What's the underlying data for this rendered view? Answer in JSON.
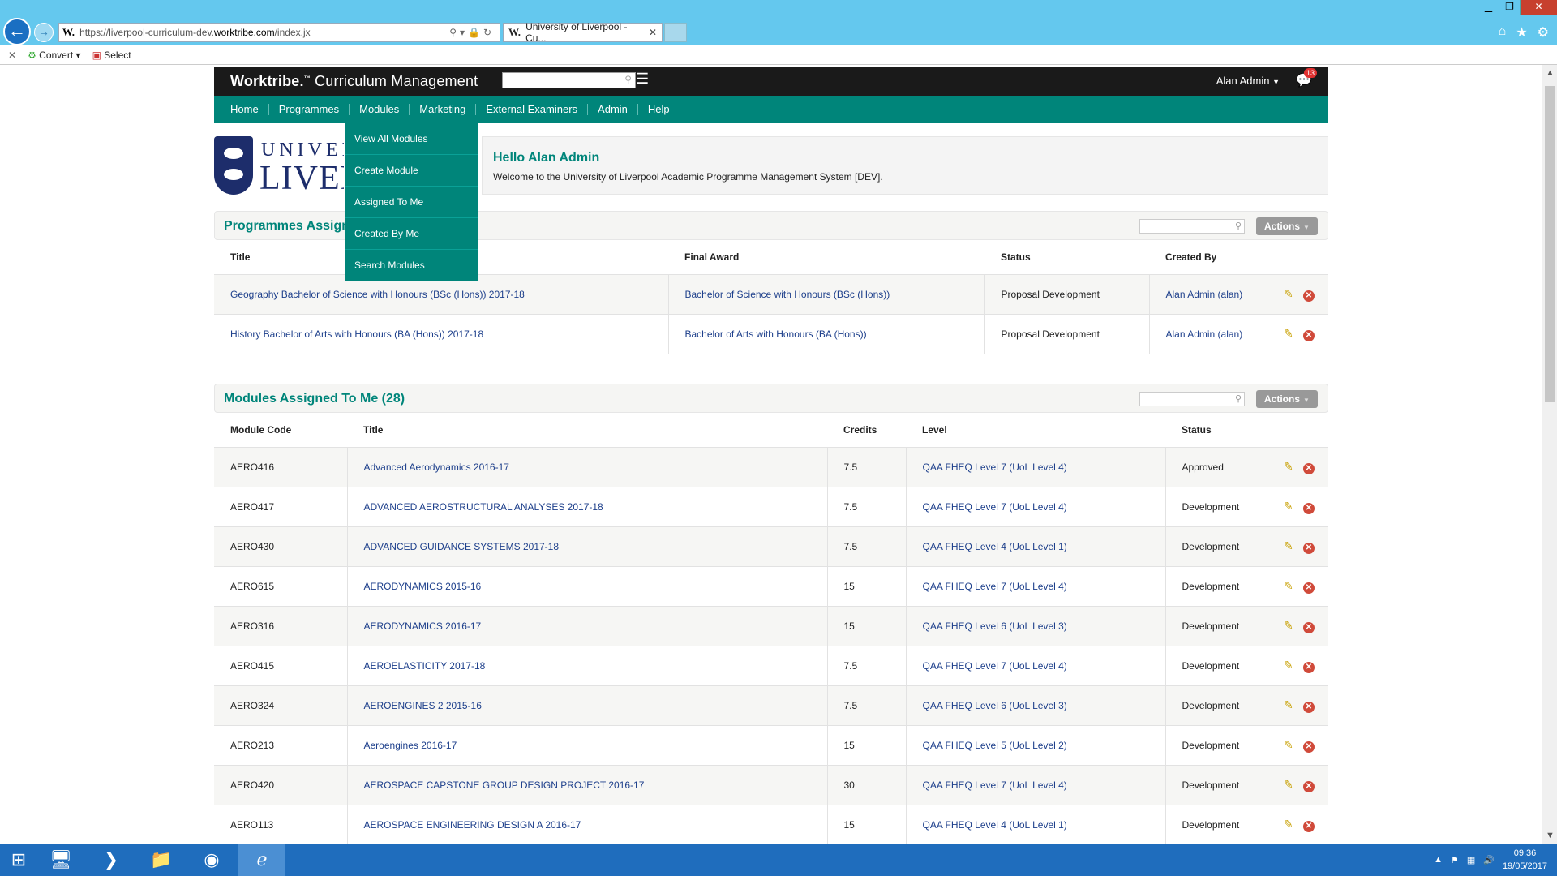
{
  "browser": {
    "url_prefix": "https://liverpool-curriculum-dev.",
    "url_domain": "worktribe.com",
    "url_path": "/index.jx",
    "tab_title": "University of Liverpool - Cu...",
    "favicon": "W.",
    "cmd_convert": "Convert",
    "cmd_select": "Select"
  },
  "app": {
    "brand": "Worktribe.",
    "brand_tm": "™",
    "brand_sub": "Curriculum Management",
    "user": "Alan Admin",
    "notifications": "13"
  },
  "nav": [
    "Home",
    "Programmes",
    "Modules",
    "Marketing",
    "External Examiners",
    "Admin",
    "Help"
  ],
  "modules_menu": [
    "View All Modules",
    "Create Module",
    "Assigned To Me",
    "Created By Me",
    "Search Modules"
  ],
  "logo": {
    "line1": "UNIVER",
    "line2": "LIVER"
  },
  "welcome": {
    "heading": "Hello Alan Admin",
    "text": "Welcome to the University of Liverpool Academic Programme Management System [DEV]."
  },
  "programmes": {
    "title": "Programmes Assigned To Me",
    "actions": "Actions",
    "headers": [
      "Title",
      "Final Award",
      "Status",
      "Created By"
    ],
    "rows": [
      [
        "Geography Bachelor of Science with Honours (BSc (Hons)) 2017-18",
        "Bachelor of Science with Honours (BSc (Hons))",
        "Proposal Development",
        "Alan Admin (alan)"
      ],
      [
        "History Bachelor of Arts with Honours (BA (Hons)) 2017-18",
        "Bachelor of Arts with Honours (BA (Hons))",
        "Proposal Development",
        "Alan Admin (alan)"
      ]
    ]
  },
  "modules": {
    "title": "Modules Assigned To Me (28)",
    "actions": "Actions",
    "headers": [
      "Module Code",
      "Title",
      "Credits",
      "Level",
      "Status"
    ],
    "rows": [
      [
        "AERO416",
        "Advanced Aerodynamics 2016-17",
        "7.5",
        "QAA FHEQ Level 7 (UoL Level 4)",
        "Approved"
      ],
      [
        "AERO417",
        "ADVANCED AEROSTRUCTURAL ANALYSES 2017-18",
        "7.5",
        "QAA FHEQ Level 7 (UoL Level 4)",
        "Development"
      ],
      [
        "AERO430",
        "ADVANCED GUIDANCE SYSTEMS 2017-18",
        "7.5",
        "QAA FHEQ Level 4 (UoL Level 1)",
        "Development"
      ],
      [
        "AERO615",
        "AERODYNAMICS 2015-16",
        "15",
        "QAA FHEQ Level 7 (UoL Level 4)",
        "Development"
      ],
      [
        "AERO316",
        "AERODYNAMICS 2016-17",
        "15",
        "QAA FHEQ Level 6 (UoL Level 3)",
        "Development"
      ],
      [
        "AERO415",
        "AEROELASTICITY 2017-18",
        "7.5",
        "QAA FHEQ Level 7 (UoL Level 4)",
        "Development"
      ],
      [
        "AERO324",
        "AEROENGINES 2 2015-16",
        "7.5",
        "QAA FHEQ Level 6 (UoL Level 3)",
        "Development"
      ],
      [
        "AERO213",
        "Aeroengines 2016-17",
        "15",
        "QAA FHEQ Level 5 (UoL Level 2)",
        "Development"
      ],
      [
        "AERO420",
        "AEROSPACE CAPSTONE GROUP DESIGN PROJECT 2016-17",
        "30",
        "QAA FHEQ Level 7 (UoL Level 4)",
        "Development"
      ],
      [
        "AERO113",
        "AEROSPACE ENGINEERING DESIGN A 2016-17",
        "15",
        "QAA FHEQ Level 4 (UoL Level 1)",
        "Development"
      ]
    ]
  },
  "taskbar": {
    "time": "09:36",
    "date": "19/05/2017"
  },
  "colors": {
    "teal": "#00857a",
    "dark": "#1a1a1a",
    "link": "#1d3f8b",
    "taskbar": "#1f6dbd"
  }
}
